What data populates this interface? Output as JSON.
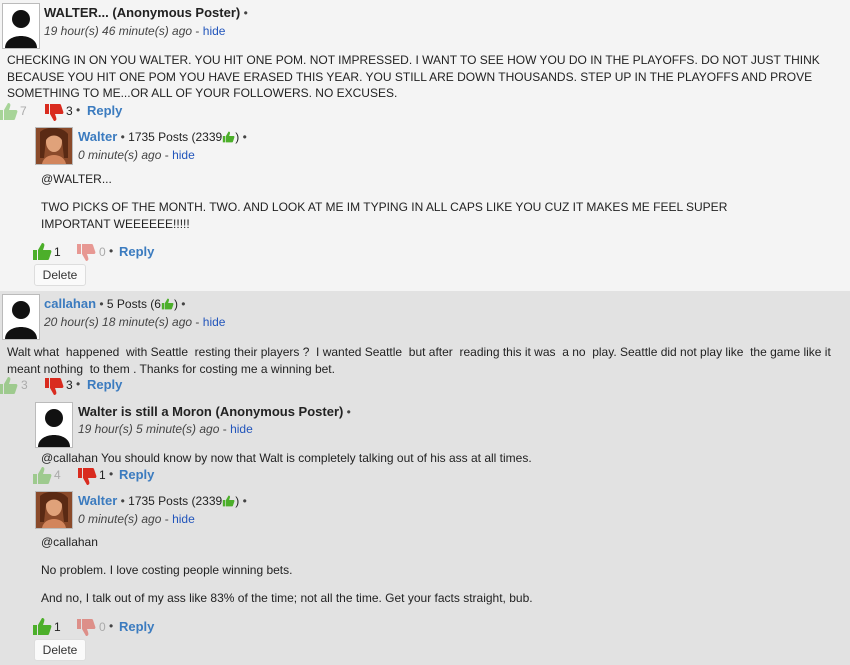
{
  "comments": [
    {
      "name": "WALTER... (Anonymous Poster)",
      "time": "19 hour(s) 46 minute(s) ago",
      "hide": "hide",
      "text": "CHECKING IN ON YOU WALTER. YOU HIT ONE POM. NOT IMPRESSED. I WANT TO SEE HOW YOU DO IN THE PLAYOFFS. DO NOT JUST THINK BECAUSE YOU HIT ONE POM YOU HAVE ERASED THIS YEAR. YOU STILL ARE DOWN THOUSANDS. STEP UP IN THE PLAYOFFS AND PROVE SOMETHING TO ME...OR ALL OF YOUR FOLLOWERS. NO EXCUSES.",
      "up": "7",
      "down": "3",
      "reply": "Reply"
    },
    {
      "name": "Walter",
      "posts": "1735 Posts (2339",
      "time": "0 minute(s) ago",
      "hide": "hide",
      "p1": "@WALTER...",
      "p2": "TWO PICKS OF THE MONTH. TWO. AND LOOK AT ME IM TYPING IN ALL CAPS LIKE YOU CUZ IT MAKES ME FEEL SUPER IMPORTANT WEEEEEE!!!!!",
      "up": "1",
      "down": "0",
      "reply": "Reply",
      "delete": "Delete"
    },
    {
      "name": "callahan",
      "posts": "5 Posts (6",
      "time": "20 hour(s) 18 minute(s) ago",
      "hide": "hide",
      "text": "Walt what  happened  with Seattle  resting their players ?  I wanted Seattle  but after  reading this it was  a no  play. Seattle did not play like  the game like it meant nothing  to them . Thanks for costing me a winning bet.",
      "up": "3",
      "down": "3",
      "reply": "Reply"
    },
    {
      "name": "Walter is still a Moron (Anonymous Poster)",
      "time": "19 hour(s) 5 minute(s) ago",
      "hide": "hide",
      "text": "@callahan You should know by now that Walt is completely talking out of his ass at all times.",
      "up": "4",
      "down": "1",
      "reply": "Reply"
    },
    {
      "name": "Walter",
      "posts": "1735 Posts (2339",
      "time": "0 minute(s) ago",
      "hide": "hide",
      "p1": "@callahan",
      "p2": "No problem. I love costing people winning bets.",
      "p3": "And no, I talk out of my ass like 83% of the time; not all the time. Get your facts straight, bub.",
      "up": "1",
      "down": "0",
      "reply": "Reply",
      "delete": "Delete"
    }
  ],
  "symbols": {
    "dot": "•",
    "sep": "-",
    "close_paren": ")"
  },
  "colors": {
    "accent": "#3b7bbf",
    "up_green": "#4caf2a",
    "down_red": "#d92b1f",
    "hide_link": "#2255bb"
  },
  "icons": [
    "thumbs-up-icon",
    "thumbs-down-icon",
    "default-avatar-icon",
    "user-photo"
  ]
}
